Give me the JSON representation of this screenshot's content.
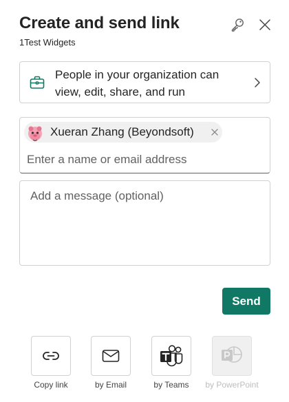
{
  "header": {
    "title": "Create and send link",
    "subtitle": "1Test Widgets"
  },
  "permission": {
    "text": "People in your organization can view, edit, share, and run"
  },
  "recipients": {
    "chips": [
      {
        "name": "Xueran Zhang (Beyondsoft)"
      }
    ],
    "placeholder": "Enter a name or email address"
  },
  "message": {
    "placeholder": "Add a message (optional)"
  },
  "send_label": "Send",
  "share_options": [
    {
      "label": "Copy link",
      "icon": "link-icon",
      "enabled": true
    },
    {
      "label": "by Email",
      "icon": "mail-icon",
      "enabled": true
    },
    {
      "label": "by Teams",
      "icon": "teams-icon",
      "enabled": true
    },
    {
      "label": "by PowerPoint",
      "icon": "powerpoint-icon",
      "enabled": false
    }
  ],
  "colors": {
    "accent": "#117865",
    "text": "#242424",
    "border": "#d1d1d1",
    "teams": "#242424",
    "disabled": "#bdbdbd"
  }
}
